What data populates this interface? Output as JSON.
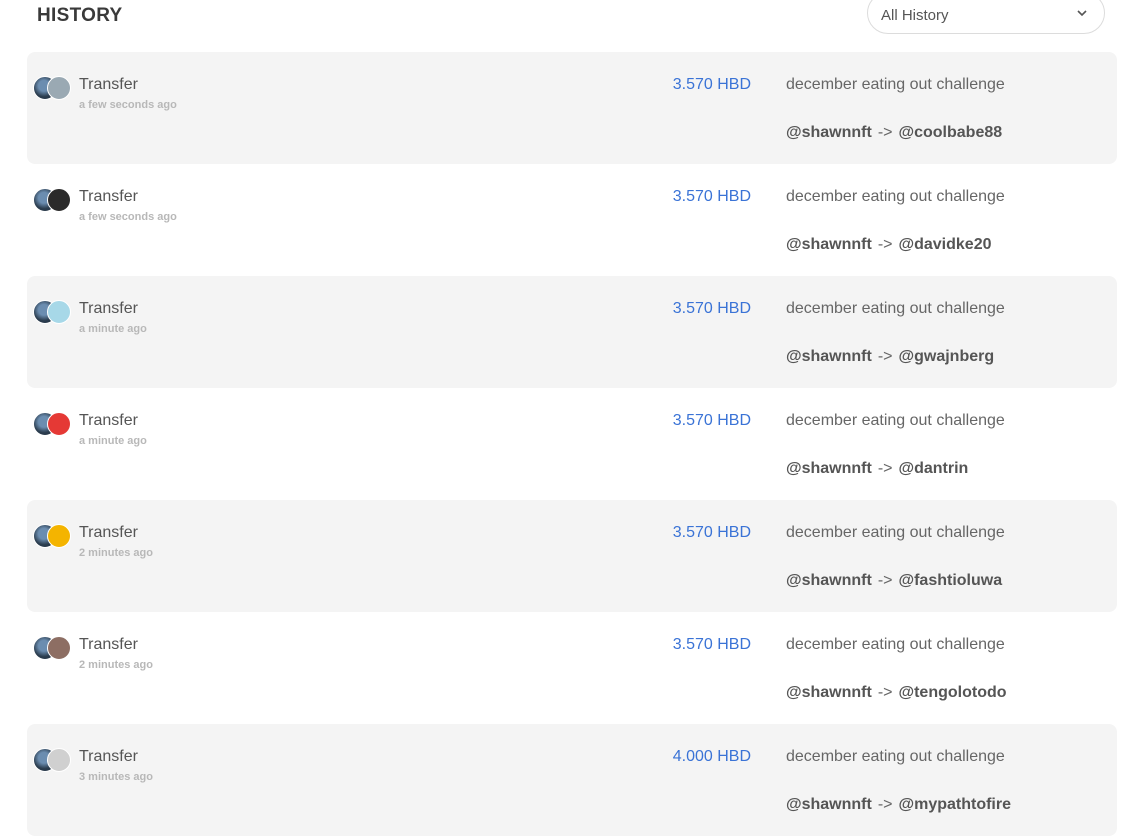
{
  "header": {
    "title": "HISTORY",
    "filter": {
      "selected": "All History",
      "icon": "chevron-down-icon"
    }
  },
  "history": [
    {
      "type": "Transfer",
      "time": "a few seconds ago",
      "amount": "3.570 HBD",
      "memo": "december eating out challenge",
      "from": "@shawnnft",
      "arrow": "->",
      "to": "@coolbabe88",
      "to_avatar_color": "#9aa9b3"
    },
    {
      "type": "Transfer",
      "time": "a few seconds ago",
      "amount": "3.570 HBD",
      "memo": "december eating out challenge",
      "from": "@shawnnft",
      "arrow": "->",
      "to": "@davidke20",
      "to_avatar_color": "#2a2a2a"
    },
    {
      "type": "Transfer",
      "time": "a minute ago",
      "amount": "3.570 HBD",
      "memo": "december eating out challenge",
      "from": "@shawnnft",
      "arrow": "->",
      "to": "@gwajnberg",
      "to_avatar_color": "#a7d8e8"
    },
    {
      "type": "Transfer",
      "time": "a minute ago",
      "amount": "3.570 HBD",
      "memo": "december eating out challenge",
      "from": "@shawnnft",
      "arrow": "->",
      "to": "@dantrin",
      "to_avatar_color": "#e53935"
    },
    {
      "type": "Transfer",
      "time": "2 minutes ago",
      "amount": "3.570 HBD",
      "memo": "december eating out challenge",
      "from": "@shawnnft",
      "arrow": "->",
      "to": "@fashtioluwa",
      "to_avatar_color": "#f4b400"
    },
    {
      "type": "Transfer",
      "time": "2 minutes ago",
      "amount": "3.570 HBD",
      "memo": "december eating out challenge",
      "from": "@shawnnft",
      "arrow": "->",
      "to": "@tengolotodo",
      "to_avatar_color": "#8d6e63"
    },
    {
      "type": "Transfer",
      "time": "3 minutes ago",
      "amount": "4.000 HBD",
      "memo": "december eating out challenge",
      "from": "@shawnnft",
      "arrow": "->",
      "to": "@mypathtofire",
      "to_avatar_color": "#d0d0d0"
    }
  ],
  "colors": {
    "amount": "#3a73d6",
    "row_shade": "#f4f4f4",
    "time": "#b8b8b8"
  }
}
